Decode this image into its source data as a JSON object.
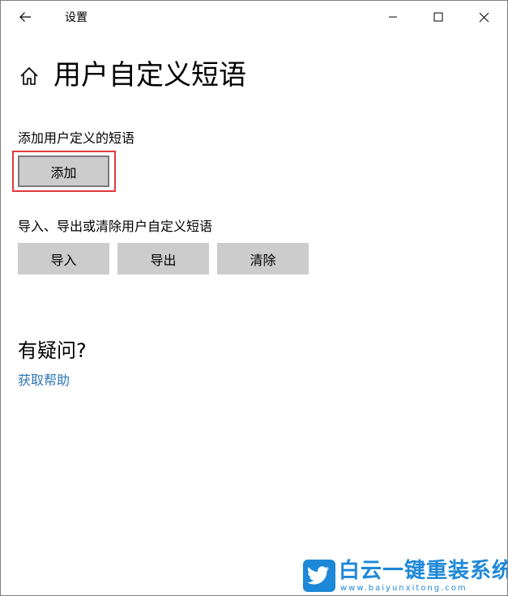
{
  "window": {
    "title": "设置"
  },
  "page": {
    "title": "用户自定义短语"
  },
  "add_section": {
    "label": "添加用户定义的短语",
    "add_button": "添加"
  },
  "manage_section": {
    "label": "导入、导出或清除用户自定义短语",
    "import_button": "导入",
    "export_button": "导出",
    "clear_button": "清除"
  },
  "help": {
    "heading": "有疑问?",
    "link": "获取帮助"
  },
  "watermark": {
    "title": "白云一键重装系统",
    "url": "www.baiyunxitong.com"
  },
  "icons": {
    "back": "arrow-left-icon",
    "minimize": "minimize-icon",
    "maximize": "maximize-icon",
    "close": "close-icon",
    "home": "home-icon",
    "logo": "twitter-bird-icon"
  },
  "colors": {
    "button_bg": "#cccccc",
    "highlight": "#e0393e",
    "link": "#2f77b7",
    "watermark": "#1e88d8"
  }
}
